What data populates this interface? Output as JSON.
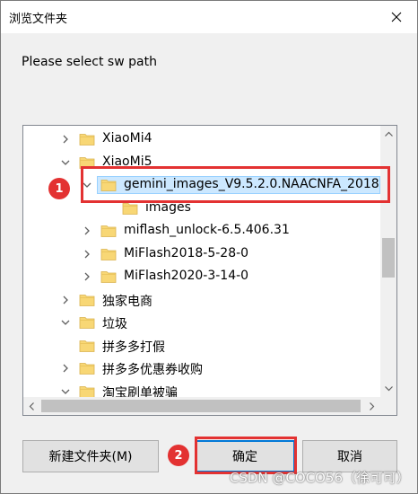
{
  "window": {
    "title": "浏览文件夹"
  },
  "prompt": "Please select sw path",
  "tree": {
    "items": [
      {
        "label": "XiaoMi4",
        "expander": "collapsed",
        "level": 1
      },
      {
        "label": "XiaoMi5",
        "expander": "expanded",
        "level": 1
      },
      {
        "label": "gemini_images_V9.5.2.0.NAACNFA_2018",
        "expander": "expanded",
        "level": 2,
        "selected": true
      },
      {
        "label": "images",
        "expander": "none",
        "level": 3
      },
      {
        "label": "miflash_unlock-6.5.406.31",
        "expander": "collapsed",
        "level": 2
      },
      {
        "label": "MiFlash2018-5-28-0",
        "expander": "collapsed",
        "level": 2
      },
      {
        "label": "MiFlash2020-3-14-0",
        "expander": "collapsed",
        "level": 2
      },
      {
        "label": "独家电商",
        "expander": "collapsed",
        "level": 1
      },
      {
        "label": "垃圾",
        "expander": "expanded",
        "level": 1
      },
      {
        "label": "拼多多打假",
        "expander": "none",
        "level": 1
      },
      {
        "label": "拼多多优惠券收购",
        "expander": "collapsed",
        "level": 1
      },
      {
        "label": "淘宝刷单被骗",
        "expander": "expanded",
        "level": 1
      }
    ]
  },
  "buttons": {
    "new_folder": "新建文件夹(M)",
    "ok": "确定",
    "cancel": "取消"
  },
  "annotations": {
    "badge1": "1",
    "badge2": "2"
  },
  "watermark": "CSDN @COCO56（徐可可）",
  "colors": {
    "selection_bg": "#cce8ff",
    "selection_border": "#99d1ff",
    "annotation_red": "#e33232",
    "folder_yellow": "#f8d775",
    "default_button_border": "#0078d7"
  },
  "icons": {
    "close": "close-icon",
    "folder": "folder-icon",
    "expander_collapsed": "chevron-right-icon",
    "expander_expanded": "chevron-down-icon"
  }
}
